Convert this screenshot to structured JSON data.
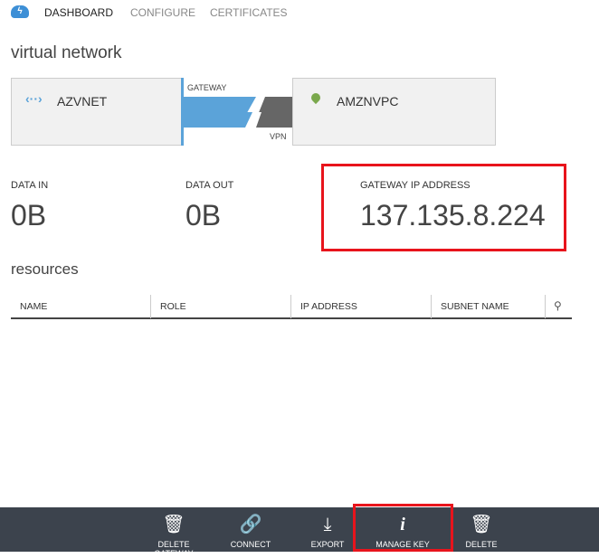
{
  "tabs": [
    "DASHBOARD",
    "CONFIGURE",
    "CERTIFICATES"
  ],
  "section_title": "virtual network",
  "network": {
    "local": "AZVNET",
    "remote": "AMZNVPC",
    "gateway_label": "GATEWAY",
    "vpn_label": "VPN"
  },
  "stats": [
    {
      "label": "DATA IN",
      "value": "0B"
    },
    {
      "label": "DATA OUT",
      "value": "0B"
    },
    {
      "label": "GATEWAY IP ADDRESS",
      "value": "137.135.8.224"
    }
  ],
  "resources": {
    "title": "resources",
    "columns": [
      "NAME",
      "ROLE",
      "IP ADDRESS",
      "SUBNET NAME"
    ]
  },
  "toolbar": [
    "DELETE GATEWAY",
    "CONNECT",
    "EXPORT",
    "MANAGE KEY",
    "DELETE"
  ],
  "colors": {
    "accent": "#5ba3d9",
    "toolbar": "#3c434d",
    "highlight": "#e8141c",
    "pin": "#7aa84c"
  }
}
